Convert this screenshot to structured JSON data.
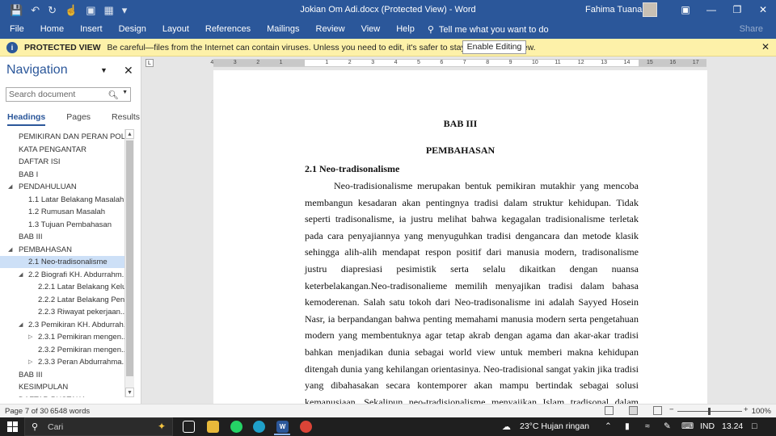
{
  "window": {
    "title": "Jokian Om Adi.docx (Protected View)  -  Word",
    "user": "Fahima Tuanany"
  },
  "ribbon": {
    "tabs": [
      "File",
      "Home",
      "Insert",
      "Design",
      "Layout",
      "References",
      "Mailings",
      "Review",
      "View",
      "Help"
    ],
    "tell_me": "Tell me what you want to do",
    "share": "Share"
  },
  "protected_view": {
    "label": "PROTECTED VIEW",
    "message": "Be careful—files from the Internet can contain viruses. Unless you need to edit, it's safer to stay in Protected View.",
    "button": "Enable Editing"
  },
  "navigation": {
    "title": "Navigation",
    "search_placeholder": "Search document",
    "tabs": [
      "Headings",
      "Pages",
      "Results"
    ],
    "active_tab": "Headings",
    "items": [
      {
        "label": "PEMIKIRAN DAN PERAN POLI...",
        "level": 1,
        "toggle": ""
      },
      {
        "label": "KATA PENGANTAR",
        "level": 1,
        "toggle": ""
      },
      {
        "label": "DAFTAR ISI",
        "level": 1,
        "toggle": ""
      },
      {
        "label": "BAB I",
        "level": 1,
        "toggle": ""
      },
      {
        "label": "PENDAHULUAN",
        "level": 1,
        "toggle": "◢"
      },
      {
        "label": "1.1 Latar Belakang Masalah",
        "level": 2,
        "toggle": ""
      },
      {
        "label": "1.2 Rumusan Masalah",
        "level": 2,
        "toggle": ""
      },
      {
        "label": "1.3 Tujuan Pembahasan",
        "level": 2,
        "toggle": ""
      },
      {
        "label": "BAB III",
        "level": 1,
        "toggle": ""
      },
      {
        "label": "PEMBAHASAN",
        "level": 1,
        "toggle": "◢"
      },
      {
        "label": "2.1 Neo-tradisonalisme",
        "level": 2,
        "toggle": "",
        "selected": true
      },
      {
        "label": "2.2 Biografi KH. Abdurrahm...",
        "level": 2,
        "toggle": "◢"
      },
      {
        "label": "2.2.1 Latar Belakang Kelu...",
        "level": 3,
        "toggle": ""
      },
      {
        "label": "2.2.2 Latar Belakang Pen...",
        "level": 3,
        "toggle": ""
      },
      {
        "label": "2.2.3 Riwayat pekerjaan...",
        "level": 3,
        "toggle": ""
      },
      {
        "label": "2.3 Pemikiran KH. Abdurrah...",
        "level": 2,
        "toggle": "◢"
      },
      {
        "label": "2.3.1 Pemikiran mengen...",
        "level": 3,
        "toggle": "▷"
      },
      {
        "label": "2.3.2 Pemikiran mengen...",
        "level": 3,
        "toggle": ""
      },
      {
        "label": "2.3.3 Peran Abdurrahma...",
        "level": 3,
        "toggle": "▷"
      },
      {
        "label": "BAB III",
        "level": 1,
        "toggle": ""
      },
      {
        "label": "KESIMPULAN",
        "level": 1,
        "toggle": ""
      },
      {
        "label": "DAFTAR PUSTAKA",
        "level": 1,
        "toggle": ""
      }
    ]
  },
  "ruler": {
    "ticks": [
      "4",
      "3",
      "2",
      "1",
      "1",
      "2",
      "3",
      "4",
      "5",
      "6",
      "7",
      "8",
      "9",
      "10",
      "11",
      "12",
      "13",
      "14",
      "15",
      "16",
      "17"
    ]
  },
  "document": {
    "chapter": "BAB III",
    "heading": "PEMBAHASAN",
    "subheading": "2.1 Neo-tradisonalisme",
    "paragraph": "Neo-tradisionalisme merupakan bentuk pemikiran mutakhir yang mencoba membangun kesadaran akan pentingnya tradisi dalam struktur kehidupan. Tidak seperti tradisonalisme, ia justru melihat bahwa kegagalan tradisionalisme terletak pada cara penyajiannya yang menyuguhkan tradisi dengancara dan metode klasik sehingga alih-alih mendapat respon positif dari manusia modern, tradisonalisme justru diapresiasi pesimistik serta selalu dikaitkan dengan nuansa keterbelakangan.Neo-tradisonalieme memilih menyajikan tradisi dalam bahasa kemoderenan. Salah satu tokoh dari Neo-tradisonalisme ini adalah Sayyed Hosein Nasr, ia berpandangan bahwa penting memahami manusia modern serta pengetahuan modern yang membentuknya agar tetap akrab dengan agama dan akar-akar tradisi bahkan menjadikan dunia sebagai world view untuk memberi makna kehidupan ditengah dunia yang kehilangan orientasinya. Neo-tradisional sangat yakin jika tradisi yang dibahasakan secara kontemporer akan mampu bertindak sebagai solusi kemanusiaan. Sekalipun neo-tradisionalisme menyajikan Islam tradisonal dalam bahasa kontemporer, namun mereka tidak sampai"
  },
  "status": {
    "page": "Page 7 of 30",
    "words": "6548 words",
    "zoom": "100%"
  },
  "taskbar": {
    "search": "Cari",
    "weather": "23°C  Hujan ringan",
    "lang": "IND",
    "time": "13.24"
  }
}
